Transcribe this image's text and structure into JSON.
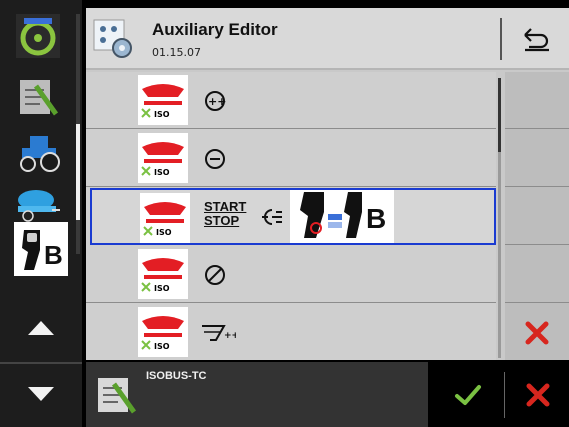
{
  "header": {
    "title": "Auxiliary Editor",
    "subtitle": "01.15.07"
  },
  "rows": [
    {
      "function_icon": "plus-circle-icon",
      "selected": false
    },
    {
      "function_icon": "minus-circle-icon",
      "selected": false
    },
    {
      "function_label_line1": "START",
      "function_label_line2": "STOP",
      "selected": true
    },
    {
      "function_icon": "no-entry-circle-icon",
      "selected": false
    },
    {
      "function_icon": "spread-plus-icon",
      "selected": false
    }
  ],
  "assigned_input": {
    "letter": "B"
  },
  "rail": {
    "joystick_letter": "B"
  },
  "bottom": {
    "tc_label": "ISOBUS-TC"
  },
  "colors": {
    "accent_blue": "#1a3bd1",
    "ok_green": "#7ac142",
    "cancel_red": "#d7261e",
    "isobus_red": "#e31e24"
  }
}
